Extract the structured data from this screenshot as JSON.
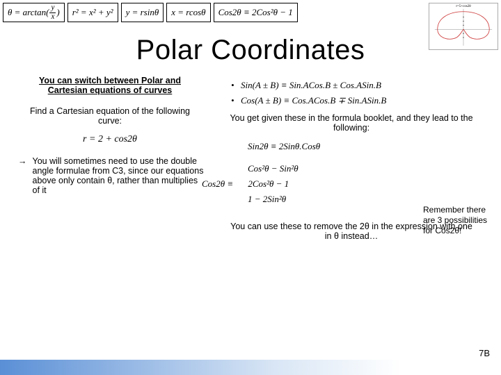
{
  "formulas": {
    "theta": "θ = arctan",
    "theta_frac_n": "y",
    "theta_frac_d": "x",
    "r2": "r² = x² + y²",
    "y": "y = rsinθ",
    "x": "x = rcosθ",
    "cos2": "Cos2θ ≡ 2Cos²θ − 1"
  },
  "thumb_caption": "r=5+cos2θ",
  "title": "Polar Coordinates",
  "left": {
    "heading": "You can switch between Polar and Cartesian equations of curves",
    "sub": "Find a Cartesian equation of the following curve:",
    "eq": "r = 2 + cos2θ",
    "arrow": "→",
    "bullet": "You will sometimes need to use the double angle formulae from C3, since our equations above only contain θ, rather than multiplies of it"
  },
  "right": {
    "id1": "Sin(A ± B) ≡ Sin.ACos.B ± Cos.ASin.B",
    "id2": "Cos(A ± B) ≡ Cos.ACos.B ∓ Sin.ASin.B",
    "lead": "You get given these in the formula booklet, and they lead to the following:",
    "eq1": "Sin2θ ≡ 2Sinθ.Cosθ",
    "eq2": "Cos²θ − Sin²θ",
    "eq3_pre": "Cos2θ ≡",
    "eq3": "2Cos²θ − 1",
    "eq4": "1 − 2Sin²θ",
    "note": "Remember there are 3 possibilities for Cos2θ!",
    "closing": "You can use these to remove the 2θ in the expression with one in θ instead…"
  },
  "page": "7B"
}
